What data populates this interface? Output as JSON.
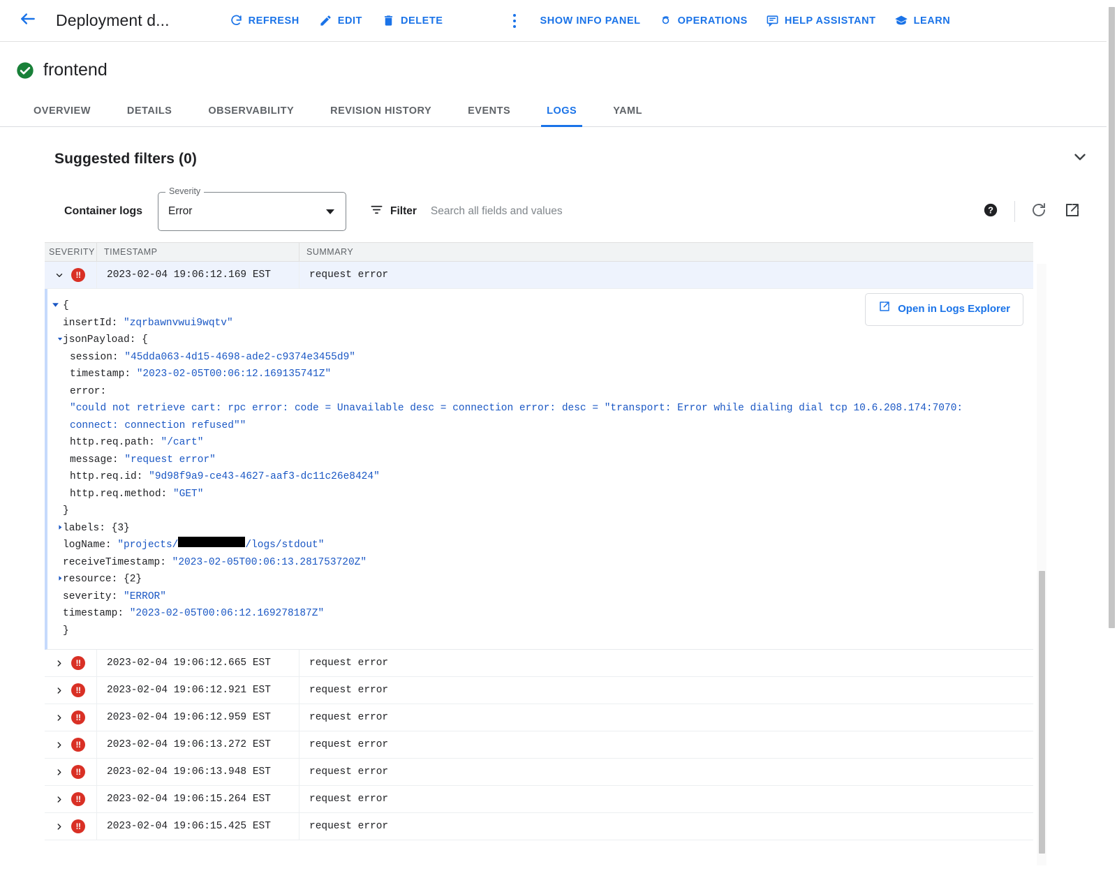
{
  "toolbar": {
    "back_label": "back-arrow",
    "title": "Deployment d...",
    "actions": [
      {
        "label": "REFRESH",
        "icon": "refresh-icon"
      },
      {
        "label": "EDIT",
        "icon": "pencil-icon"
      },
      {
        "label": "DELETE",
        "icon": "trash-icon"
      }
    ],
    "overflow_icon": "kebab-menu-icon",
    "right_actions": [
      {
        "label": "SHOW INFO PANEL",
        "icon": ""
      },
      {
        "label": "OPERATIONS",
        "icon": "operations-icon"
      },
      {
        "label": "HELP ASSISTANT",
        "icon": "chat-icon"
      },
      {
        "label": "LEARN",
        "icon": "learn-icon"
      }
    ]
  },
  "resource": {
    "name": "frontend",
    "status_icon": "check-circle-icon",
    "status_color": "#188038"
  },
  "tabs": [
    {
      "label": "OVERVIEW",
      "active": false
    },
    {
      "label": "DETAILS",
      "active": false
    },
    {
      "label": "OBSERVABILITY",
      "active": false
    },
    {
      "label": "REVISION HISTORY",
      "active": false
    },
    {
      "label": "EVENTS",
      "active": false
    },
    {
      "label": "LOGS",
      "active": true
    },
    {
      "label": "YAML",
      "active": false
    }
  ],
  "suggested_filters": {
    "title": "Suggested filters (0)",
    "collapse_icon": "chevron-down-icon"
  },
  "log_controls": {
    "container_logs_label": "Container logs",
    "severity_legend": "Severity",
    "severity_value": "Error",
    "severity_options": [
      "Error"
    ],
    "filter_label": "Filter",
    "search_placeholder": "Search all fields and values",
    "search_value": "",
    "help_icon": "help-icon",
    "refresh_icon": "refresh-circle-icon",
    "open_new_icon": "open-in-new-icon"
  },
  "table": {
    "columns": [
      "SEVERITY",
      "TIMESTAMP",
      "SUMMARY"
    ],
    "rows": [
      {
        "timestamp": "2023-02-04 19:06:12.169 EST",
        "summary": "request error",
        "severity": "error",
        "expanded": true
      },
      {
        "timestamp": "2023-02-04 19:06:12.665 EST",
        "summary": "request error",
        "severity": "error",
        "expanded": false
      },
      {
        "timestamp": "2023-02-04 19:06:12.921 EST",
        "summary": "request error",
        "severity": "error",
        "expanded": false
      },
      {
        "timestamp": "2023-02-04 19:06:12.959 EST",
        "summary": "request error",
        "severity": "error",
        "expanded": false
      },
      {
        "timestamp": "2023-02-04 19:06:13.272 EST",
        "summary": "request error",
        "severity": "error",
        "expanded": false
      },
      {
        "timestamp": "2023-02-04 19:06:13.948 EST",
        "summary": "request error",
        "severity": "error",
        "expanded": false
      },
      {
        "timestamp": "2023-02-04 19:06:15.264 EST",
        "summary": "request error",
        "severity": "error",
        "expanded": false
      },
      {
        "timestamp": "2023-02-04 19:06:15.425 EST",
        "summary": "request error",
        "severity": "error",
        "expanded": false
      }
    ]
  },
  "detail": {
    "open_explorer_label": "Open in Logs Explorer",
    "open_explorer_icon": "open-in-new-icon",
    "brace_open": "{",
    "brace_close": "}",
    "lines": {
      "insert_id_key": "insertId: ",
      "insert_id_val": "\"zqrbawnvwui9wqtv\"",
      "json_payload_key": "jsonPayload: {",
      "session_key": "session: ",
      "session_val": "\"45dda063-4d15-4698-ade2-c9374e3455d9\"",
      "timestamp_key": "timestamp: ",
      "timestamp_val": "\"2023-02-05T00:06:12.169135741Z\"",
      "error_key": "error:",
      "error_val_line1": "\"could not retrieve cart: rpc error: code = Unavailable desc = connection error: desc = \"transport: Error while dialing dial tcp 10.6.208.174:7070:",
      "error_val_line2": "connect: connection refused\"\"",
      "req_path_key": "http.req.path: ",
      "req_path_val": "\"/cart\"",
      "message_key": "message: ",
      "message_val": "\"request error\"",
      "req_id_key": "http.req.id: ",
      "req_id_val": "\"9d98f9a9-ce43-4627-aaf3-dc11c26e8424\"",
      "req_method_key": "http.req.method: ",
      "req_method_val": "\"GET\"",
      "inner_close": "}",
      "labels_key": "labels: {3}",
      "log_name_key": "logName: ",
      "log_name_prefix": "\"projects/",
      "log_name_suffix": "/logs/stdout\"",
      "receive_ts_key": "receiveTimestamp: ",
      "receive_ts_val": "\"2023-02-05T00:06:13.281753720Z\"",
      "resource_key": "resource: {2}",
      "severity_key": "severity: ",
      "severity_val": "\"ERROR\"",
      "ts_key": "timestamp: ",
      "ts_val": "\"2023-02-05T00:06:12.169278187Z\"",
      "outer_close": "}"
    }
  },
  "colors": {
    "accent": "#1a73e8",
    "error": "#d93025",
    "success": "#188038",
    "json_value": "#1a57c4"
  }
}
